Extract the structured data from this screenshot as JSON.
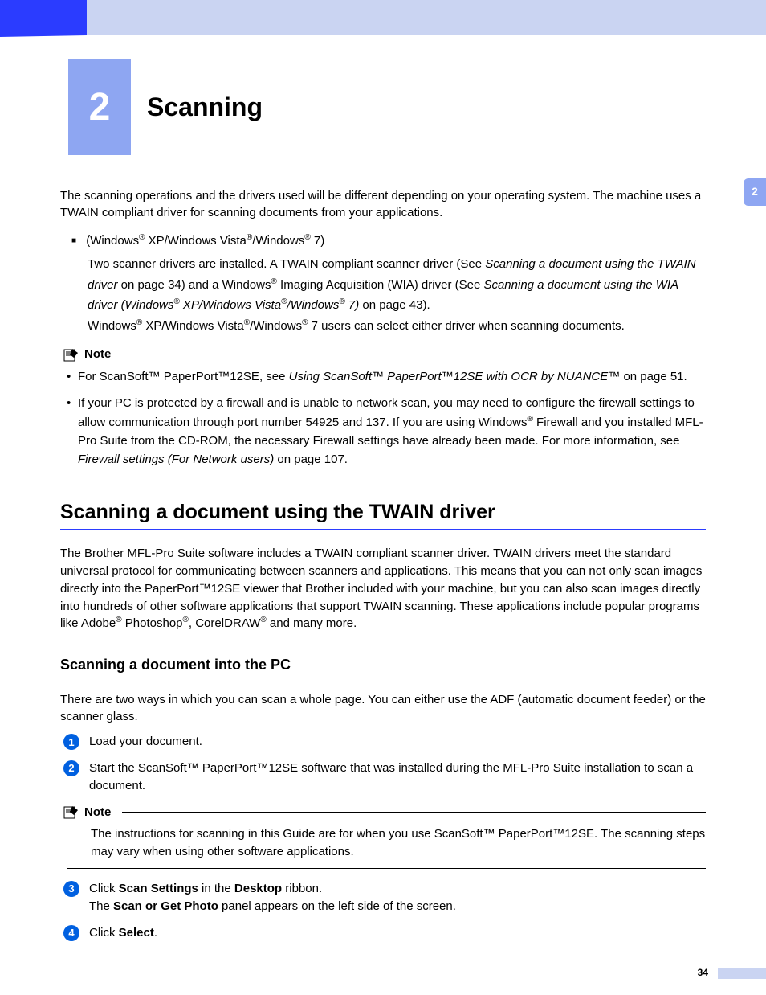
{
  "chapter": {
    "number": "2",
    "title": "Scanning"
  },
  "tab": "2",
  "intro": "The scanning operations and the drivers used will be different depending on your operating system. The machine uses a TWAIN compliant driver for scanning documents from your applications.",
  "bullet": {
    "head_pre": "(Windows",
    "head_xp": " XP/Windows Vista",
    "head_7": "/Windows",
    "head_end": " 7)",
    "body_1": "Two scanner drivers are installed. A TWAIN compliant scanner driver (See ",
    "body_1_link": "Scanning a document using the TWAIN driver",
    "body_1_mid": " on page 34) and a Windows",
    "body_1_mid2": " Imaging Acquisition (WIA) driver (See ",
    "body_1_link2": "Scanning a document using the WIA driver (Windows",
    "body_1_link2b": " XP/Windows Vista",
    "body_1_link2c": "/Windows",
    "body_1_link2d": " 7)",
    "body_1_end": " on page 43).",
    "body_2_a": "Windows",
    "body_2_b": " XP/Windows Vista",
    "body_2_c": "/Windows",
    "body_2_d": " 7 users can select either driver when scanning documents."
  },
  "note1": {
    "label": "Note",
    "li1_a": "For ScanSoft™ PaperPort™12SE, see ",
    "li1_link": "Using ScanSoft™ PaperPort™12SE with OCR by NUANCE™",
    "li1_b": " on page 51.",
    "li2_a": "If your PC is protected by a firewall and is unable to network scan, you may need to configure the firewall settings to allow communication through port number 54925 and 137. If you are using Windows",
    "li2_b": " Firewall and you installed MFL-Pro Suite from the CD-ROM, the necessary Firewall settings have already been made. For more information, see ",
    "li2_link": "Firewall settings (For Network users)",
    "li2_c": " on page 107."
  },
  "h2": "Scanning a document using the TWAIN driver",
  "twain_p1": "The Brother MFL-Pro Suite software includes a TWAIN compliant scanner driver. TWAIN drivers meet the standard universal protocol for communicating between scanners and applications. This means that you can not only scan images directly into the PaperPort™12SE viewer that Brother included with your machine, but you can also scan images directly into hundreds of other software applications that support TWAIN scanning. These applications include popular programs like Adobe",
  "twain_p1_b": " Photoshop",
  "twain_p1_c": ", CorelDRAW",
  "twain_p1_d": " and many more.",
  "h3": "Scanning a document into the PC",
  "pc_intro": "There are two ways in which you can scan a whole page. You can either use the ADF (automatic document feeder) or the scanner glass.",
  "steps": {
    "s1": "Load your document.",
    "s2": "Start the ScanSoft™ PaperPort™12SE software that was installed during the MFL-Pro Suite installation to scan a document.",
    "s3_a": "Click ",
    "s3_b": "Scan Settings",
    "s3_c": " in the ",
    "s3_d": "Desktop",
    "s3_e": " ribbon.",
    "s3_f": "The ",
    "s3_g": "Scan or Get Photo",
    "s3_h": " panel appears on the left side of the screen.",
    "s4_a": "Click ",
    "s4_b": "Select",
    "s4_c": "."
  },
  "note2": {
    "label": "Note",
    "body": "The instructions for scanning in this Guide are for when you use ScanSoft™ PaperPort™12SE. The scanning steps may vary when using other software applications."
  },
  "page_number": "34"
}
